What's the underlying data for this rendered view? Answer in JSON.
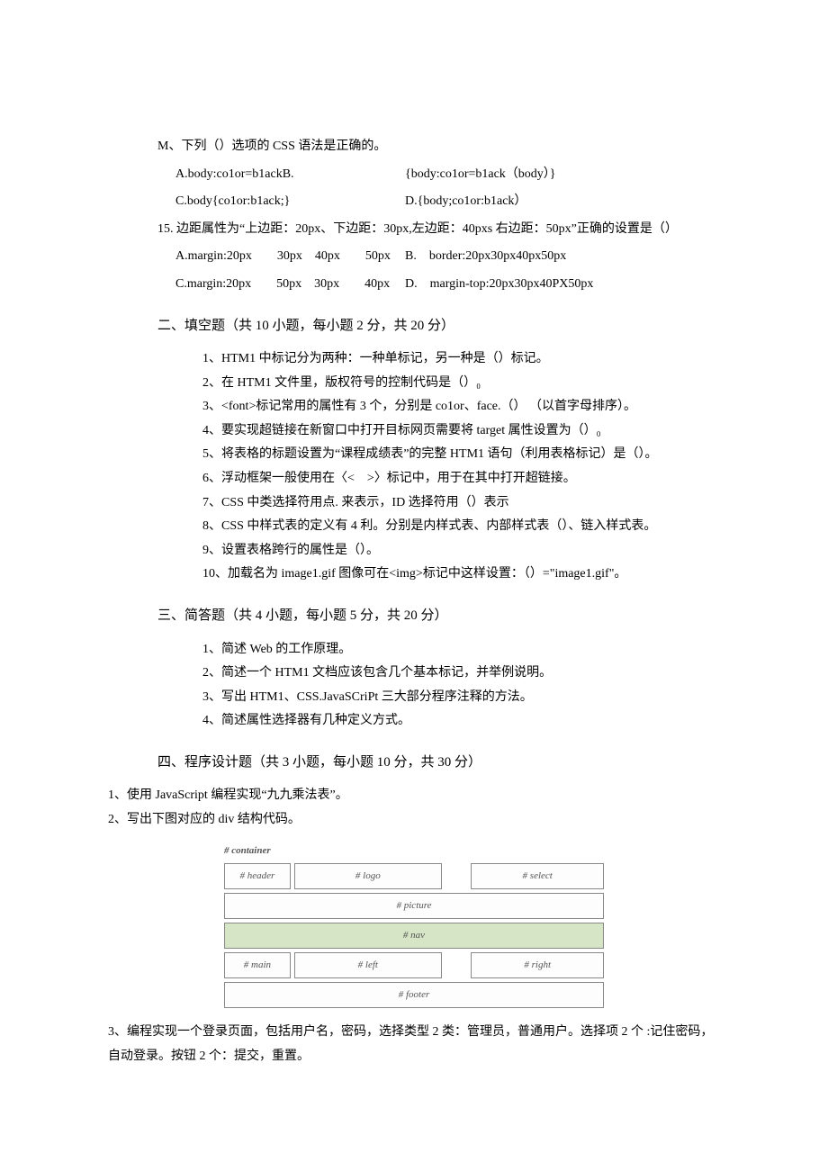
{
  "q14": {
    "stem": "M、下列（）选项的 CSS 语法是正确的。",
    "optA_label": "A.body:co1or=b1ackB.",
    "optA_right": "{body:co1or=b1ack（body）}",
    "optC": "C.body{co1or:b1ack;}",
    "optD": "D.{body;co1or:b1ack）"
  },
  "q15": {
    "stem": "15. 边距属性为“上边距：20px、下边距：30px,左边距：40pxs 右边距：50px”正确的设置是（）",
    "rowA": "A.margin:20px  30px 40px  50px",
    "rowA_right": "B. border:20px30px40px50px",
    "rowC": "C.margin:20px  50px 30px  40px",
    "rowC_right": "D. margin-top:20px30px40PX50px"
  },
  "sec2_title": "二、填空题（共 10 小题，每小题 2 分，共 20 分）",
  "fill": [
    "1、HTM1 中标记分为两种：一种单标记，另一种是（）标记。",
    "2、在 HTM1 文件里，版权符号的控制代码是（）₀",
    "3、<font>标记常用的属性有 3 个，分别是 co1or、face.（） （以首字母排序）。",
    "4、要实现超链接在新窗口中打开目标网页需要将 target 属性设置为（）₀",
    "5、将表格的标题设置为“课程成绩表”的完整 HTM1 语句（利用表格标记）是（）。",
    "6、浮动框架一般使用在〈< >〉标记中，用于在其中打开超链接。",
    "7、CSS 中类选择符用点. 来表示，ID 选择符用（）表示",
    "8、CSS 中样式表的定义有 4 利。分别是内样式表、内部样式表（）、链入样式表。",
    "9、设置表格跨行的属性是（）。",
    "10、加载名为 image1.gif 图像可在<img>标记中这样设置：（）=\"image1.gif\"。"
  ],
  "sec3_title": "三、简答题（共 4 小题，每小题 5 分，共 20 分）",
  "sa": [
    "1、简述 Web 的工作原理。",
    "2、简述一个 HTM1 文档应该包含几个基本标记，并举例说明。",
    "3、写出 HTM1、CSS.JavaSCriPt 三大部分程序注释的方法。",
    "4、简述属性选择器有几种定义方式。"
  ],
  "sec4_title": "四、程序设计题（共 3 小题，每小题 10 分，共 30 分）",
  "prog1": "1、使用 JavaScript 编程实现“九九乘法表”。",
  "prog2": "2、写出下图对应的 div 结构代码。",
  "prog3": "3、编程实现一个登录页面，包括用户名，密码，选择类型 2 类：管理员，普通用户。选择项 2 个 :记住密码，自动登录。按钮 2 个：提交，重置。",
  "diagram": {
    "container": "# container",
    "header": "# header",
    "logo": "# logo",
    "select": "# select",
    "picture": "# picture",
    "nav": "# nav",
    "main": "# main",
    "left": "# left",
    "right": "# right",
    "footer": "# footer"
  }
}
